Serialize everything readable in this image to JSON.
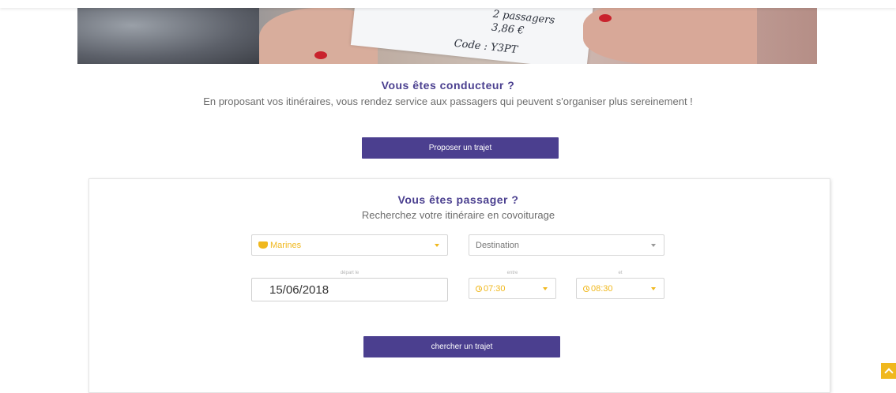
{
  "hero": {
    "ticket_lines": [
      "2 passagers",
      "3,86 €",
      "Code : Y3PT"
    ]
  },
  "driver": {
    "title": "Vous êtes conducteur ?",
    "subtitle": "En proposant vos itinéraires, vous rendez service aux passagers qui peuvent s'organiser plus sereinement !",
    "button_label": "Proposer un trajet"
  },
  "passenger": {
    "title": "Vous êtes passager ?",
    "subtitle": "Recherchez votre itinéraire en covoiturage",
    "origin": {
      "value": "Marines",
      "icon": "flag-icon"
    },
    "destination": {
      "placeholder": "Destination"
    },
    "depart_label": "départ le",
    "date_value": "15/06/2018",
    "between_label": "entre",
    "and_label": "et",
    "time_from": "07:30",
    "time_to": "08:30",
    "search_label": "chercher un trajet"
  },
  "colors": {
    "primary": "#4b3f8f",
    "accent": "#f0b81e",
    "text_muted": "#6d6d6d"
  },
  "icons": {
    "scroll_top": "chevron-up-icon",
    "clock": "clock-icon",
    "caret": "caret-down-icon"
  }
}
